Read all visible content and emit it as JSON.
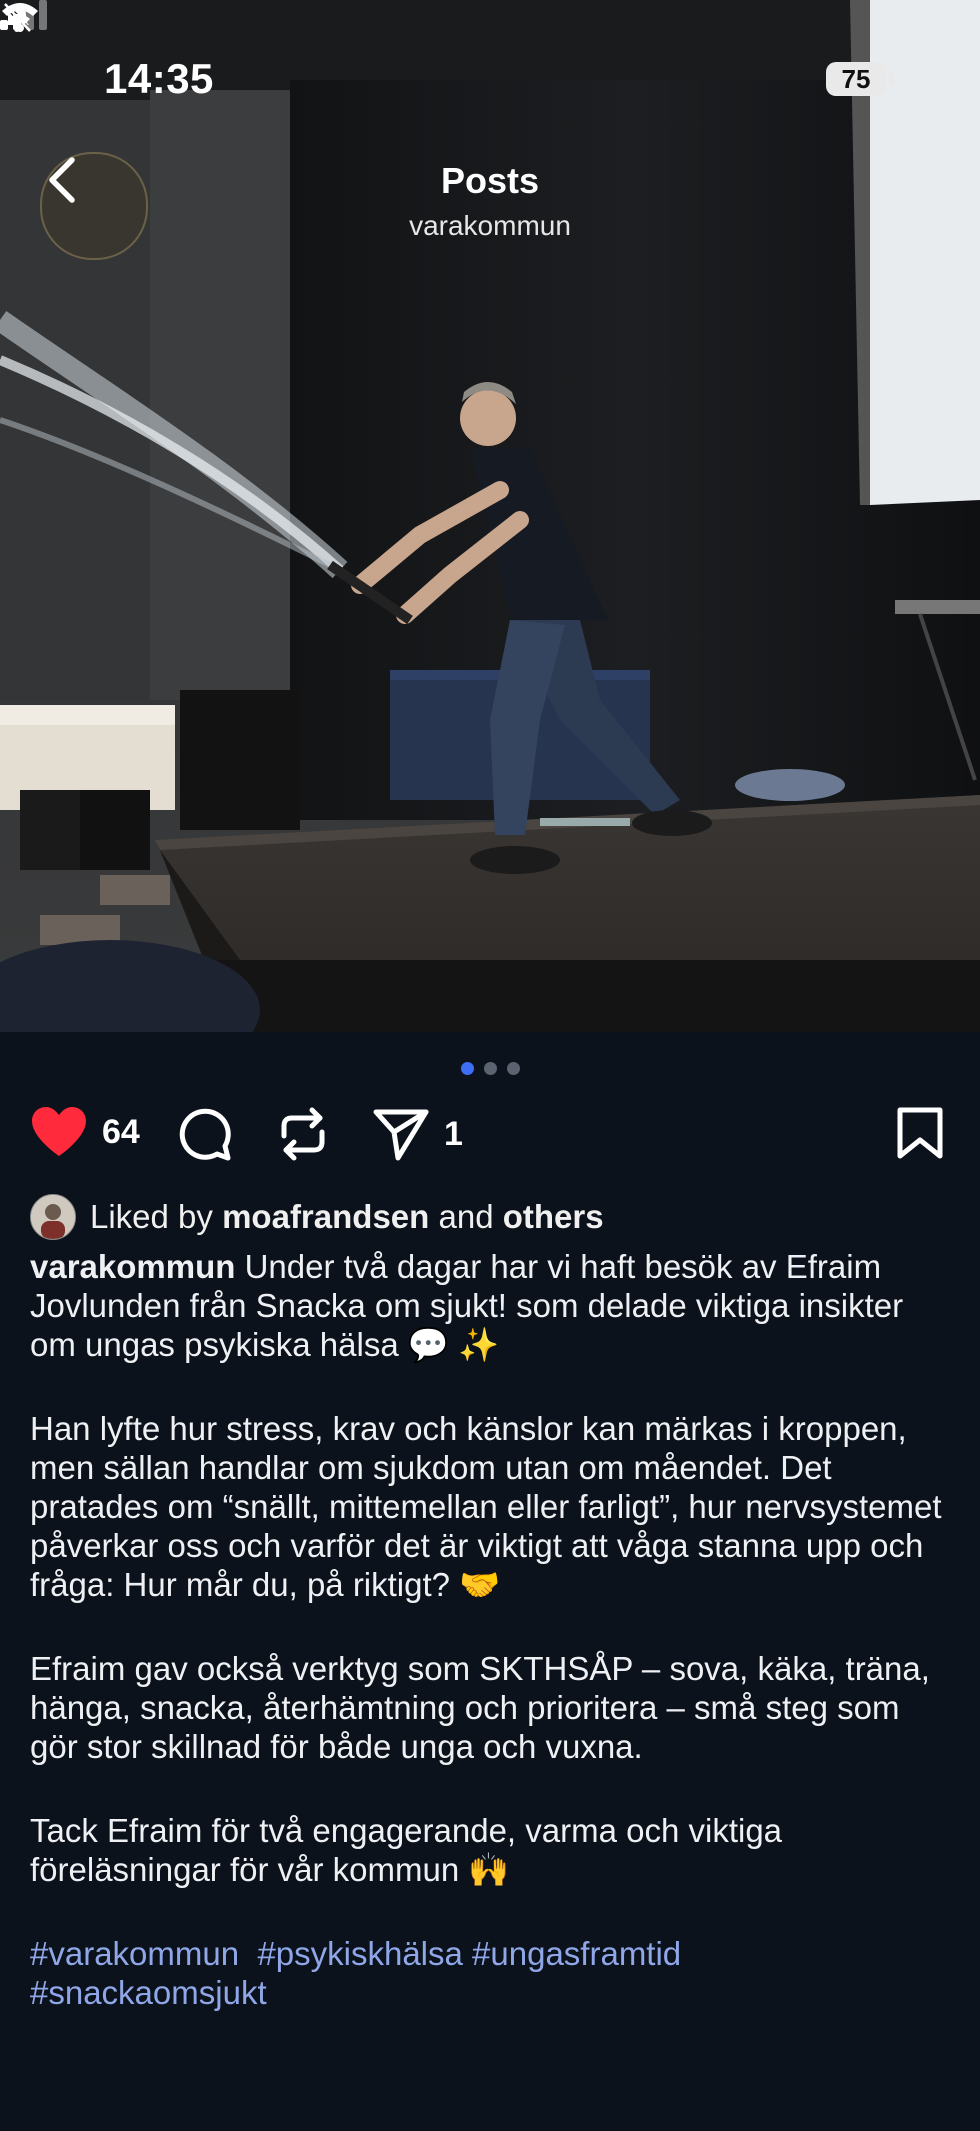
{
  "status_bar": {
    "time": "14:35",
    "battery": "75",
    "icons": [
      "bell-slash-icon",
      "cellular-signal-icon",
      "wifi-icon",
      "battery-icon"
    ]
  },
  "nav": {
    "title": "Posts",
    "subtitle": "varakommun",
    "back_icon": "chevron-left-icon"
  },
  "pager": {
    "count": 3,
    "active": 0
  },
  "actions": {
    "like_count": "64",
    "share_count": "1",
    "icons": [
      "heart-icon",
      "comment-icon",
      "repost-icon",
      "send-icon",
      "bookmark-icon"
    ],
    "like_color": "#ff2a3b"
  },
  "likes": {
    "prefix": "Liked by",
    "user": "moafrandsen",
    "and": "and",
    "others": "others"
  },
  "caption": {
    "username": "varakommun",
    "p1": "Under två dagar har vi haft besök av Efraim Jovlunden från Snacka om sjukt! som delade viktiga insikter om ungas psykiska hälsa 💬 ✨",
    "p2": "Han lyfte hur stress, krav och känslor kan märkas i kroppen, men sällan handlar om sjukdom utan om måendet. Det pratades om “snällt, mittemellan eller farligt”, hur nervsystemet påverkar oss och varför det är viktigt att våga stanna upp och fråga: Hur mår du, på riktigt? 🤝",
    "p3": "Efraim gav också verktyg som SKTHSÅP – sova, käka, träna, hänga, snacka, återhämtning och prioritera – små steg som gör stor skillnad för både unga och vuxna.",
    "p4": "Tack Efraim för två engagerande, varma och viktiga föreläsningar för vår kommun 🙌",
    "hashtags": [
      "#varakommun",
      "#psykiskhälsa",
      "#ungasframtid",
      "#snackaomsjukt"
    ]
  },
  "colors": {
    "background": "#0c121b",
    "hashtag": "#8fa7e8",
    "pager_active": "#3d6ef5"
  }
}
